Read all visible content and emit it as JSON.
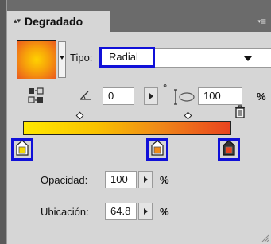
{
  "panel": {
    "title": "Degradado",
    "tab_arrows": "▴▾",
    "menu_icon": "panel-menu-icon"
  },
  "gradient": {
    "swatch_colors": [
      "#ffd200",
      "#f7a10a",
      "#ea5a1f"
    ],
    "type_label": "Tipo:",
    "type_value": "Radial",
    "angle_value": "0",
    "degree_symbol": "°",
    "aspect_value": "100",
    "aspect_unit": "%",
    "bar_colors": [
      "#ffe800",
      "#f9c200",
      "#f08a18",
      "#e9431f"
    ],
    "stops": [
      {
        "color": "#f2d800",
        "selected": false
      },
      {
        "color": "#f08a18",
        "selected": false
      },
      {
        "color": "#e9431f",
        "selected": true
      }
    ]
  },
  "stop_props": {
    "opacity_label": "Opacidad:",
    "opacity_value": "100",
    "opacity_unit": "%",
    "location_label": "Ubicación:",
    "location_value": "64.8",
    "location_unit": "%"
  },
  "highlight_color": "#1010d8"
}
